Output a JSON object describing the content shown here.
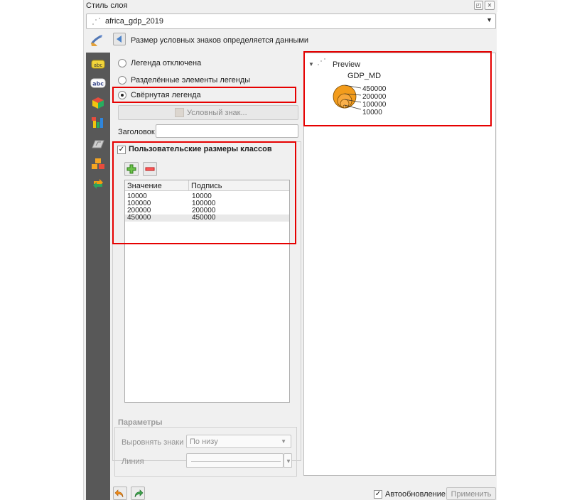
{
  "window": {
    "title": "Стиль слоя"
  },
  "layer_combo": {
    "value": "africa_gdp_2019"
  },
  "header": {
    "title": "Размер условных знаков определяется данными"
  },
  "legend_options": [
    {
      "label": "Легенда отключена",
      "selected": false
    },
    {
      "label": "Разделённые элементы легенды",
      "selected": false
    },
    {
      "label": "Свёрнутая легенда",
      "selected": true
    }
  ],
  "symbol_button": {
    "label": "Условный знак..."
  },
  "title_field": {
    "label": "Заголовок",
    "value": ""
  },
  "custom_sizes": {
    "label": "Пользовательские размеры классов",
    "checked": true,
    "columns": [
      "Значение",
      "Подпись"
    ],
    "rows": [
      {
        "value": "10000",
        "label": "10000"
      },
      {
        "value": "100000",
        "label": "100000"
      },
      {
        "value": "200000",
        "label": "200000"
      },
      {
        "value": "450000",
        "label": "450000"
      }
    ]
  },
  "parameters": {
    "title": "Параметры",
    "align_label": "Выровнять знаки",
    "align_value": "По низу",
    "line_label": "Линия"
  },
  "preview": {
    "title": "Preview",
    "field": "GDP_MD",
    "values": [
      "450000",
      "200000",
      "100000",
      "10000"
    ],
    "symbol_color": "#f39c1b"
  },
  "footer": {
    "autoupdate_label": "Автообновление",
    "autoupdate_checked": true,
    "apply_label": "Применить"
  },
  "colors": {
    "highlight": "#e60000"
  }
}
